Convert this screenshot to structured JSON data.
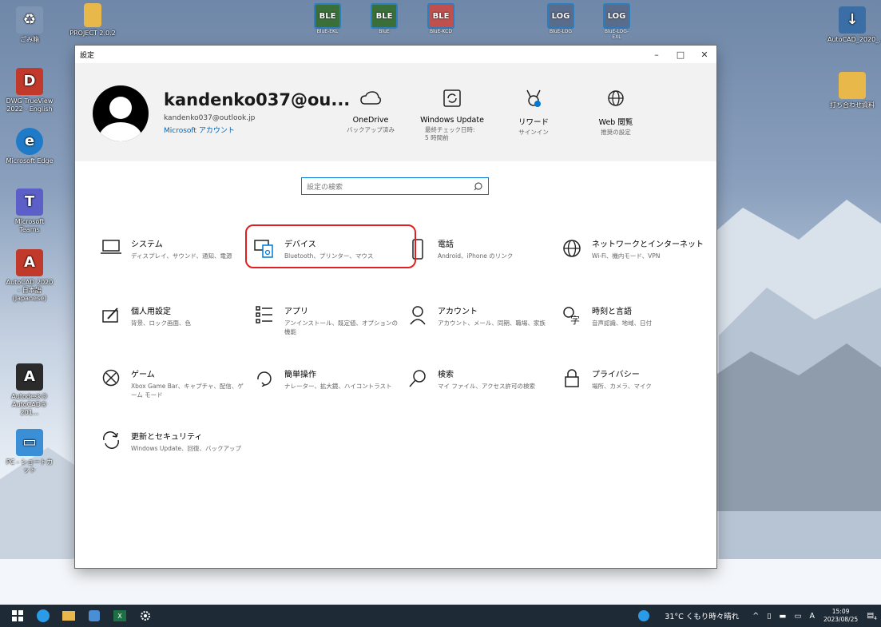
{
  "desktop": {
    "icons_left": [
      {
        "label": "ごみ箱",
        "icon": "recycle-bin-icon",
        "color": "#6a86a6"
      },
      {
        "label": "DWG TrueView 2022 - English",
        "icon": "dwg-trueview-icon",
        "color": "#c0392b"
      },
      {
        "label": "Microsoft Edge",
        "icon": "edge-icon",
        "color": "#1f7ac7"
      },
      {
        "label": "Microsoft Teams",
        "icon": "teams-icon",
        "color": "#5b5fc7"
      },
      {
        "label": "AutoCAD 2020 - 日本語 (Japanese)",
        "icon": "autocad-icon",
        "color": "#c0392b"
      },
      {
        "label": "Autodesk® AutoCAD® 201...",
        "icon": "autodesk-icon",
        "color": "#1f1f1f"
      },
      {
        "label": "PC - ショートカット",
        "icon": "pc-shortcut-icon",
        "color": "#3b8fd6"
      }
    ],
    "icon_folder_top": "PROJECT 2.0.2",
    "icons_top": [
      "BluE-EKL",
      "BluE",
      "BluE-KCD",
      "BluE-LOG",
      "BluE-LOG-EXL"
    ],
    "icons_right": [
      {
        "label": "AutoCAD_2020_...",
        "icon": "download-icon"
      },
      {
        "label": "打ち合わせ資料",
        "icon": "folder-icon"
      }
    ]
  },
  "window": {
    "title": "設定",
    "controls": {
      "minimize": "–",
      "maximize": "□",
      "close": "✕"
    },
    "account": {
      "name": "kandenko037@ou...",
      "email": "kandenko037@outlook.jp",
      "link": "Microsoft アカウント"
    },
    "header_items": [
      {
        "label": "OneDrive",
        "sub": "バックアップ済み",
        "icon": "cloud-icon"
      },
      {
        "label": "Windows Update",
        "sub": "最終チェック日時: 5 時間前",
        "icon": "windows-update-icon"
      },
      {
        "label": "リワード",
        "sub": "サインイン",
        "icon": "rewards-icon"
      },
      {
        "label": "Web 閲覧",
        "sub": "推奨の設定",
        "icon": "globe-icon"
      }
    ],
    "search_placeholder": "設定の検索",
    "categories": [
      {
        "name": "システム",
        "desc": "ディスプレイ、サウンド、通知、電源",
        "icon": "system-icon"
      },
      {
        "name": "デバイス",
        "desc": "Bluetooth、プリンター、マウス",
        "icon": "devices-icon"
      },
      {
        "name": "電話",
        "desc": "Android、iPhone のリンク",
        "icon": "phone-icon"
      },
      {
        "name": "ネットワークとインターネット",
        "desc": "Wi-Fi、機内モード、VPN",
        "icon": "network-icon"
      },
      {
        "name": "個人用設定",
        "desc": "背景、ロック画面、色",
        "icon": "personalization-icon"
      },
      {
        "name": "アプリ",
        "desc": "アンインストール、既定値、オプションの機能",
        "icon": "apps-icon"
      },
      {
        "name": "アカウント",
        "desc": "アカウント、メール、同期、職場、家族",
        "icon": "accounts-icon"
      },
      {
        "name": "時刻と言語",
        "desc": "音声認識、地域、日付",
        "icon": "time-language-icon"
      },
      {
        "name": "ゲーム",
        "desc": "Xbox Game Bar、キャプチャ、配信、ゲーム モード",
        "icon": "gaming-icon"
      },
      {
        "name": "簡単操作",
        "desc": "ナレーター、拡大鏡、ハイコントラスト",
        "icon": "ease-of-access-icon"
      },
      {
        "name": "検索",
        "desc": "マイ ファイル、アクセス許可の検索",
        "icon": "search-icon"
      },
      {
        "name": "プライバシー",
        "desc": "場所、カメラ、マイク",
        "icon": "privacy-icon"
      },
      {
        "name": "更新とセキュリティ",
        "desc": "Windows Update、回復、バックアップ",
        "icon": "update-security-icon"
      }
    ]
  },
  "taskbar": {
    "weather": "31°C くもり時々晴れ",
    "ime": "A",
    "time": "15:09",
    "date": "2023/08/25",
    "notification_count": "4"
  },
  "colors": {
    "accent": "#0078d4",
    "highlight": "#e02020",
    "taskbar": "#1f2a37"
  }
}
